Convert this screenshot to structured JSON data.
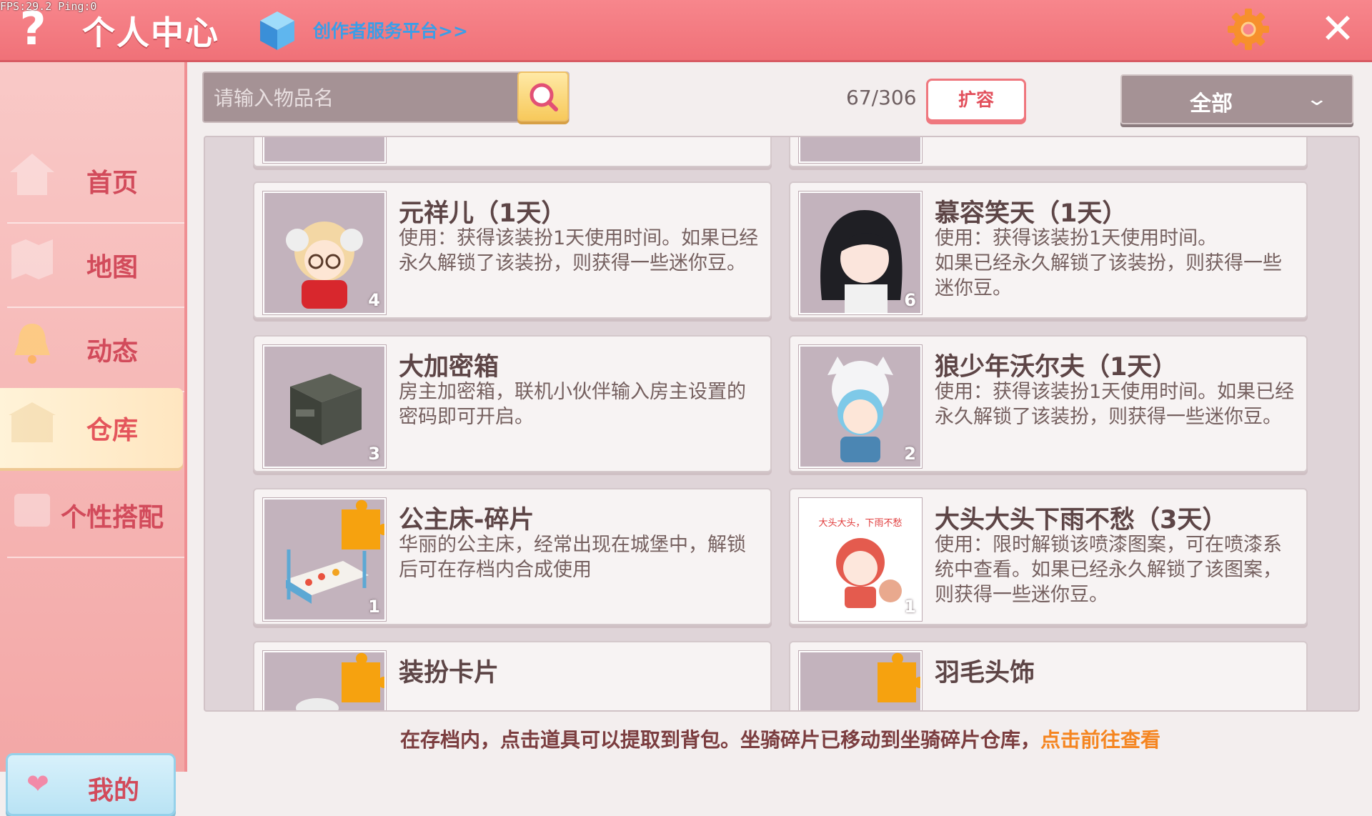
{
  "fps_text": "FPS:29.2  Ping:0",
  "header": {
    "title": "个人中心",
    "creator_link": "创作者服务平台>>"
  },
  "sidebar": {
    "items": [
      {
        "label": "首页",
        "icon": "home-icon"
      },
      {
        "label": "地图",
        "icon": "map-icon"
      },
      {
        "label": "动态",
        "icon": "bell-icon"
      },
      {
        "label": "仓库",
        "icon": "warehouse-icon",
        "active": true
      },
      {
        "label": "个性搭配",
        "icon": "outfit-icon"
      }
    ],
    "mine_label": "我的"
  },
  "toolbar": {
    "search_placeholder": "请输入物品名",
    "capacity": "67/306",
    "expand_label": "扩容",
    "filter_label": "全部"
  },
  "items": [
    {
      "name": "元祥儿（1天）",
      "desc": "使用：获得该装扮1天使用时间。如果已经永久解锁了该装扮，则获得一些迷你豆。",
      "count": "4",
      "icon": "sheep-girl-avatar"
    },
    {
      "name": "慕容笑天（1天）",
      "desc": "使用：获得该装扮1天使用时间。\n如果已经永久解锁了该装扮，则获得一些迷你豆。",
      "count": "6",
      "icon": "black-hair-avatar"
    },
    {
      "name": "大加密箱",
      "desc": "房主加密箱，联机小伙伴输入房主设置的密码即可开启。",
      "count": "3",
      "icon": "locked-box-icon"
    },
    {
      "name": "狼少年沃尔夫（1天）",
      "desc": "使用：获得该装扮1天使用时间。如果已经永久解锁了该装扮，则获得一些迷你豆。",
      "count": "2",
      "icon": "wolf-boy-avatar"
    },
    {
      "name": "公主床-碎片",
      "desc": "华丽的公主床，经常出现在城堡中，解锁后可在存档内合成使用",
      "count": "1",
      "icon": "princess-bed-fragment"
    },
    {
      "name": "大头大头下雨不愁（3天）",
      "desc": "使用：限时解锁该喷漆图案，可在喷漆系统中查看。如果已经永久解锁了该图案，则获得一些迷你豆。",
      "count": "1",
      "icon": "spray-paint-girl",
      "thumb_text": "大头大头，下雨不愁"
    },
    {
      "name": "装扮卡片",
      "desc": "",
      "count": "",
      "icon": "outfit-card-fragment"
    },
    {
      "name": "羽毛头饰",
      "desc": "",
      "count": "",
      "icon": "feather-headwear-fragment"
    }
  ],
  "footer": {
    "text": "在存档内，点击道具可以提取到背包。坐骑碎片已移动到坐骑碎片仓库，",
    "link": "点击前往查看"
  },
  "colors": {
    "header_bg": "#f07178",
    "accent_text": "#d24b5b",
    "link_orange": "#f58520",
    "creator_blue": "#3a9ee8"
  }
}
